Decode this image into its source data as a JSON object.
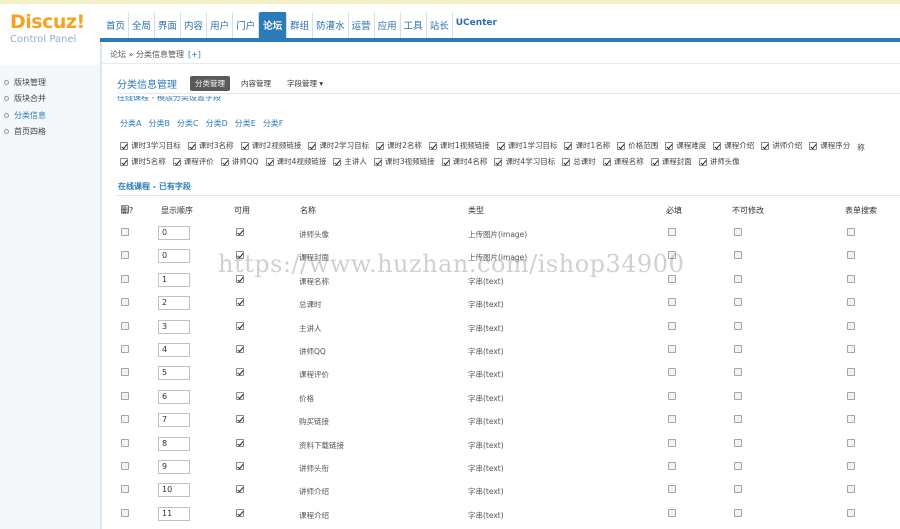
{
  "brand": {
    "name": "Discuz!",
    "subtitle": "Control Panel"
  },
  "nav": {
    "items": [
      "首页",
      "全局",
      "界面",
      "内容",
      "用户",
      "门户",
      "论坛",
      "群组",
      "防灌水",
      "运营",
      "应用",
      "工具",
      "站长",
      "UCenter"
    ],
    "active_index": 6
  },
  "sidebar": {
    "items": [
      {
        "label": "版块管理"
      },
      {
        "label": "版块合并"
      },
      {
        "label": "分类信息"
      },
      {
        "label": "首页四格"
      }
    ],
    "active_index": 2
  },
  "breadcrumb": {
    "path": "论坛 » 分类信息管理",
    "plus": "[+]"
  },
  "page_header": {
    "title": "分类信息管理",
    "tabs": [
      {
        "label": "分类管理",
        "active": true
      },
      {
        "label": "内容管理",
        "active": false
      },
      {
        "label": "字段管理 ▾",
        "active": false
      }
    ]
  },
  "clipped_text": "在线课程 - 模版分类设置字段",
  "categories": [
    "分类A",
    "分类B",
    "分类C",
    "分类D",
    "分类E",
    "分类F"
  ],
  "field_options": [
    "课时3学习目标",
    "课时3名称",
    "课时2视频链接",
    "课时2学习目标",
    "课时2名称",
    "课时1视频链接",
    "课时1学习目标",
    "课时1名称",
    "价格范围",
    "课程难度",
    "课程介绍",
    "讲师介绍",
    "课程序分",
    "称",
    "课时5名称",
    "课程评价",
    "讲师QQ",
    "课时4视频链接",
    "主讲人",
    "课时3视频链接",
    "课时4名称",
    "课时4学习目标",
    "总课时",
    "课程名称",
    "课程封面",
    "讲师头像"
  ],
  "section": {
    "title": "在线课程 - 已有字段"
  },
  "table": {
    "headers": {
      "delete": "删?",
      "order": "显示顺序",
      "enabled": "可用",
      "name": "名称",
      "type": "类型",
      "required": "必填",
      "readonly": "不可修改",
      "search": "表单搜索"
    },
    "rows": [
      {
        "order": "0",
        "name": "讲师头像",
        "type": "上传图片(image)"
      },
      {
        "order": "0",
        "name": "课程封面",
        "type": "上传图片(image)"
      },
      {
        "order": "1",
        "name": "课程名称",
        "type": "字串(text)"
      },
      {
        "order": "2",
        "name": "总课时",
        "type": "字串(text)"
      },
      {
        "order": "3",
        "name": "主讲人",
        "type": "字串(text)"
      },
      {
        "order": "4",
        "name": "讲师QQ",
        "type": "字串(text)"
      },
      {
        "order": "5",
        "name": "课程评价",
        "type": "字串(text)"
      },
      {
        "order": "6",
        "name": "价格",
        "type": "字串(text)"
      },
      {
        "order": "7",
        "name": "购买链接",
        "type": "字串(text)"
      },
      {
        "order": "8",
        "name": "资料下载链接",
        "type": "字串(text)"
      },
      {
        "order": "9",
        "name": "讲师头衔",
        "type": "字串(text)"
      },
      {
        "order": "10",
        "name": "讲师介绍",
        "type": "字串(text)"
      },
      {
        "order": "11",
        "name": "课程介绍",
        "type": "字串(text)"
      }
    ]
  },
  "watermark": "https://www.huzhan.com/ishop34900"
}
